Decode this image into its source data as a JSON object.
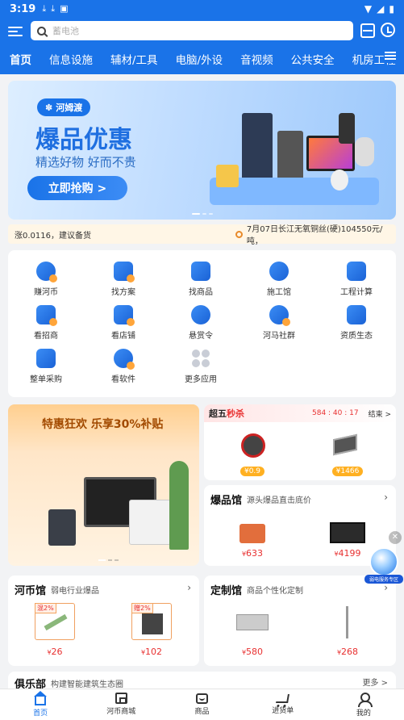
{
  "status": {
    "time": "3:19"
  },
  "search": {
    "placeholder": "蓄电池"
  },
  "categories": [
    "首页",
    "信息设施",
    "辅材/工具",
    "电脑/外设",
    "音视频",
    "公共安全",
    "机房工程"
  ],
  "banner": {
    "brand": "河姆渡",
    "headline": "爆品优惠",
    "subline": "精选好物 好而不贵",
    "cta": "立即抢购 >"
  },
  "ticker": {
    "left": "涨0.0116，建议备货",
    "right": "7月07日长江无氧铜丝(硬)104550元/吨，"
  },
  "quick": [
    {
      "label": "赚河币",
      "icon": "coin-icon"
    },
    {
      "label": "找方案",
      "icon": "document-icon"
    },
    {
      "label": "找商品",
      "icon": "basket-icon"
    },
    {
      "label": "施工馆",
      "icon": "helmet-icon"
    },
    {
      "label": "工程计算",
      "icon": "calculator-icon"
    },
    {
      "label": "看招商",
      "icon": "gift-icon"
    },
    {
      "label": "看店铺",
      "icon": "store-icon"
    },
    {
      "label": "悬赏令",
      "icon": "money-bag-icon"
    },
    {
      "label": "河马社群",
      "icon": "people-icon"
    },
    {
      "label": "资质生态",
      "icon": "briefcase-icon"
    },
    {
      "label": "整单采购",
      "icon": "truck-icon"
    },
    {
      "label": "看软件",
      "icon": "cloud-icon"
    },
    {
      "label": "更多应用",
      "icon": "more-apps-icon"
    }
  ],
  "promo": {
    "headline": "特惠狂欢 乐享30%补贴"
  },
  "flash": {
    "title1": "超五",
    "title2": "秒杀",
    "countdown": "584 : 40 : 17",
    "end": "结束 >",
    "items": [
      {
        "price": "0.9"
      },
      {
        "price": "1466"
      }
    ]
  },
  "hot": {
    "title": "爆品馆",
    "subtitle": "源头爆品直击底价",
    "items": [
      {
        "price": "633"
      },
      {
        "price": "4199"
      }
    ]
  },
  "coin": {
    "title": "河币馆",
    "subtitle": "弱电行业爆品",
    "items": [
      {
        "badge": "混2%",
        "price": "26"
      },
      {
        "badge": "赠2%",
        "price": "102"
      }
    ]
  },
  "custom": {
    "title": "定制馆",
    "subtitle": "商品个性化定制",
    "items": [
      {
        "price": "580"
      },
      {
        "price": "268"
      }
    ]
  },
  "club": {
    "title": "俱乐部",
    "subtitle": "构建智能建筑生态圈",
    "more": "更多 >"
  },
  "float": {
    "label": "弱电服务专区"
  },
  "tabs": [
    "首页",
    "河币商城",
    "商品",
    "进货单",
    "我的"
  ],
  "colors": {
    "primary": "#1a73e8",
    "price": "#e83030",
    "pill": "#ffb021"
  }
}
